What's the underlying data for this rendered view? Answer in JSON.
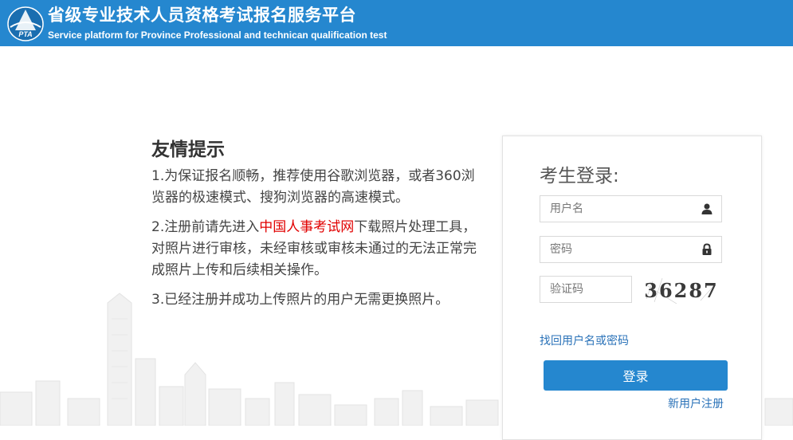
{
  "header": {
    "logo_text": "PTA",
    "title": "省级专业技术人员资格考试报名服务平台",
    "subtitle": "Service platform for Province Professional and technican qualification test"
  },
  "notice": {
    "title": "友情提示",
    "item1": "1.为保证报名顺畅，推荐使用谷歌浏览器，或者360浏览器的极速模式、搜狗浏览器的高速模式。",
    "item2_before": "2.注册前请先进入",
    "item2_link": "中国人事考试网",
    "item2_after": "下载照片处理工具，对照片进行审核，未经审核或审核未通过的无法正常完成照片上传和后续相关操作。",
    "item3": "3.已经注册并成功上传照片的用户无需更换照片。"
  },
  "login": {
    "title": "考生登录:",
    "username_placeholder": "用户名",
    "password_placeholder": "密码",
    "captcha_placeholder": "验证码",
    "captcha_text": "36287",
    "forgot_link": "找回用户名或密码",
    "login_button": "登录",
    "register_link": "新用户注册"
  },
  "colors": {
    "header_bg": "#2587cf",
    "link": "#2a72b8",
    "highlight": "#e10000"
  },
  "icons": {
    "username": "user-icon",
    "password": "lock-icon",
    "logo": "pta-logo-icon"
  }
}
